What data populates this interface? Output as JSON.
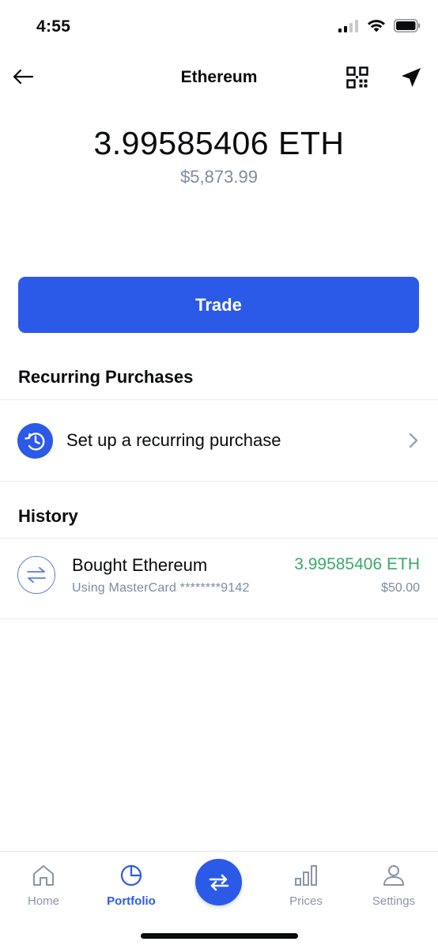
{
  "status_bar": {
    "time": "4:55",
    "icons": [
      "signal-icon",
      "wifi-icon",
      "battery-icon"
    ]
  },
  "nav": {
    "title": "Ethereum",
    "icons": [
      "back-arrow-icon",
      "qr-code-icon",
      "send-icon"
    ]
  },
  "balance": {
    "crypto": "3.99585406 ETH",
    "fiat": "$5,873.99"
  },
  "trade_button": {
    "label": "Trade"
  },
  "recurring": {
    "heading": "Recurring Purchases",
    "row_label": "Set up a recurring purchase",
    "icons": [
      "recurring-clock-icon",
      "chevron-right-icon"
    ]
  },
  "history": {
    "heading": "History",
    "items": [
      {
        "title": "Bought Ethereum",
        "subtitle": "Using MasterCard ********9142",
        "amount": "3.99585406 ETH",
        "fiat": "$50.00",
        "icon": "transfer-arrows-icon"
      }
    ]
  },
  "tabbar": {
    "home": "Home",
    "portfolio": "Portfolio",
    "prices": "Prices",
    "settings": "Settings",
    "active": "Portfolio"
  },
  "colors": {
    "accent": "#2b5ae8",
    "positive": "#3aa86b",
    "muted": "#7d8ba1",
    "text": "#0a0b0d"
  }
}
